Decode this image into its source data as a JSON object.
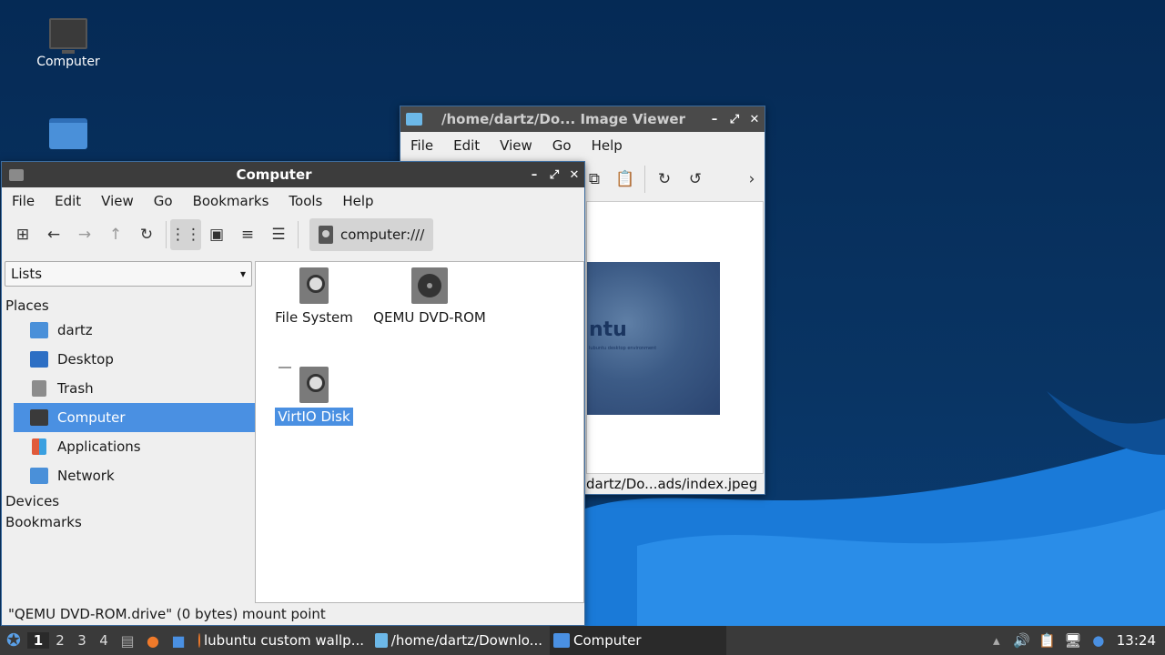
{
  "desktop": {
    "icons": [
      {
        "label": "Computer",
        "icon": "computer-icon"
      },
      {
        "label": "",
        "icon": "home-folder-icon"
      }
    ]
  },
  "viewer": {
    "title": "/home/dartz/Do... Image Viewer",
    "menu": [
      "File",
      "Edit",
      "View",
      "Go",
      "Help"
    ],
    "preview_brand": "ntu",
    "preview_tiny": "lubuntu desktop environment",
    "status": "dartz/Do...ads/index.jpeg"
  },
  "fm": {
    "title": "Computer",
    "menu": [
      "File",
      "Edit",
      "View",
      "Go",
      "Bookmarks",
      "Tools",
      "Help"
    ],
    "path": "computer:///",
    "side_mode": "Lists",
    "sections": {
      "places": "Places",
      "devices": "Devices",
      "bookmarks": "Bookmarks"
    },
    "places": [
      {
        "label": "dartz",
        "icon": "home-folder-icon",
        "color": "#4a90d9"
      },
      {
        "label": "Desktop",
        "icon": "desktop-folder-icon",
        "color": "#2d6fc4"
      },
      {
        "label": "Trash",
        "icon": "trash-icon",
        "color": "#8c8c8c"
      },
      {
        "label": "Computer",
        "icon": "computer-icon",
        "color": "#3a3a3a"
      },
      {
        "label": "Applications",
        "icon": "applications-icon",
        "color": "#e8a03a"
      },
      {
        "label": "Network",
        "icon": "network-folder-icon",
        "color": "#4a90d9"
      }
    ],
    "selected_place": "Computer",
    "items": [
      {
        "label": "File System",
        "icon": "harddisk-icon"
      },
      {
        "label": "QEMU DVD-ROM",
        "icon": "dvd-drive-icon"
      },
      {
        "label": "VirtIO Disk",
        "icon": "harddisk-icon",
        "selected": true
      }
    ],
    "status": "\"QEMU DVD-ROM.drive\" (0 bytes) mount point"
  },
  "taskbar": {
    "workspaces": [
      "1",
      "2",
      "3",
      "4"
    ],
    "current_workspace": "1",
    "tasks": [
      {
        "label": "lubuntu custom wallp...",
        "icon": "firefox-icon"
      },
      {
        "label": "/home/dartz/Downlo...",
        "icon": "image-viewer-icon"
      },
      {
        "label": "Computer",
        "icon": "folder-icon",
        "active": true
      }
    ],
    "clock": "13:24"
  },
  "colors": {
    "accent": "#4a90e2",
    "titlebar": "#3c3c3c",
    "taskbar": "#3a3a3a",
    "wallpaper": "#0b2f5a"
  }
}
